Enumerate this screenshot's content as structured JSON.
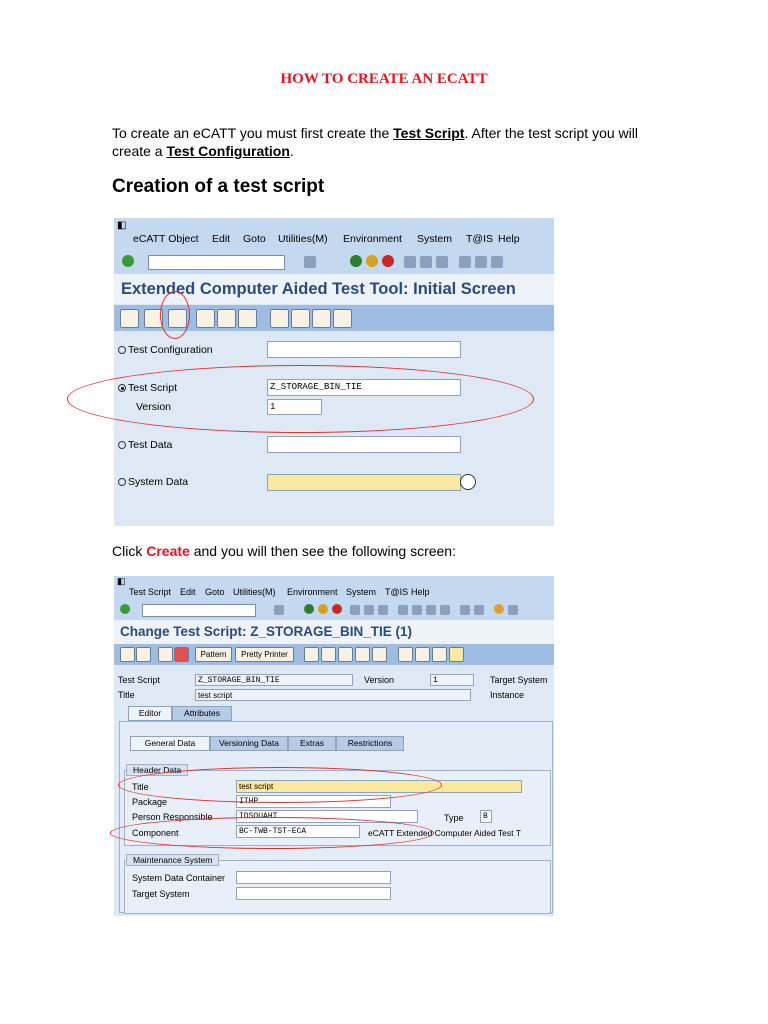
{
  "doc_title": "HOW TO CREATE AN ECATT",
  "intro": {
    "p1": "To create an eCATT you must first create the ",
    "k1": "Test Script",
    "p2": ". After the test script you will create a ",
    "k2": "Test Configuration",
    "p3": "."
  },
  "section_heading": "Creation of a test script",
  "shot1": {
    "menu": [
      "eCATT Object",
      "Edit",
      "Goto",
      "Utilities(M)",
      "Environment",
      "System",
      "T@IS",
      "Help"
    ],
    "title": "Extended Computer Aided Test Tool: Initial Screen",
    "rows": {
      "test_configuration": "Test Configuration",
      "test_script": "Test Script",
      "test_script_value": "Z_STORAGE_BIN_TIE",
      "version": "Version",
      "version_value": "1",
      "test_data": "Test Data",
      "system_data": "System Data"
    }
  },
  "click_line": {
    "pre": "Click ",
    "strong": "Create",
    "post": " and you will then see the following screen:"
  },
  "shot2": {
    "menu": [
      "Test Script",
      "Edit",
      "Goto",
      "Utilities(M)",
      "Environment",
      "System",
      "T@IS",
      "Help"
    ],
    "title": "Change Test Script: Z_STORAGE_BIN_TIE (1)",
    "buttons": {
      "pattern": "Pattern",
      "pretty_printer": "Pretty Printer"
    },
    "head": {
      "test_script_label": "Test Script",
      "test_script_value": "Z_STORAGE_BIN_TIE",
      "version_label": "Version",
      "version_value": "1",
      "target_system_label": "Target System",
      "title_label": "Title",
      "title_value": "test script",
      "instance_label": "Instance"
    },
    "main_tabs": [
      "Editor",
      "Attributes"
    ],
    "sub_tabs": [
      "General Data",
      "Versioning Data",
      "Extras",
      "Restrictions"
    ],
    "header_data": {
      "group_title": "Header Data",
      "title_label": "Title",
      "title_value": "test script",
      "package_label": "Package",
      "package_value": "ITHP",
      "person_label": "Person Responsible",
      "person_value": "IDSOUAHT",
      "type_label": "Type",
      "type_value": "B",
      "component_label": "Component",
      "component_value": "BC-TWB-TST-ECA",
      "component_desc": "eCATT Extended Computer Aided Test T"
    },
    "maintenance": {
      "group_title": "Maintenance System",
      "sdc_label": "System Data Container",
      "target_label": "Target System"
    }
  },
  "colors": {
    "heading_red": "#e8141e",
    "sap_title_blue": "#2b4a7d",
    "annotation_red": "#e0302e"
  }
}
